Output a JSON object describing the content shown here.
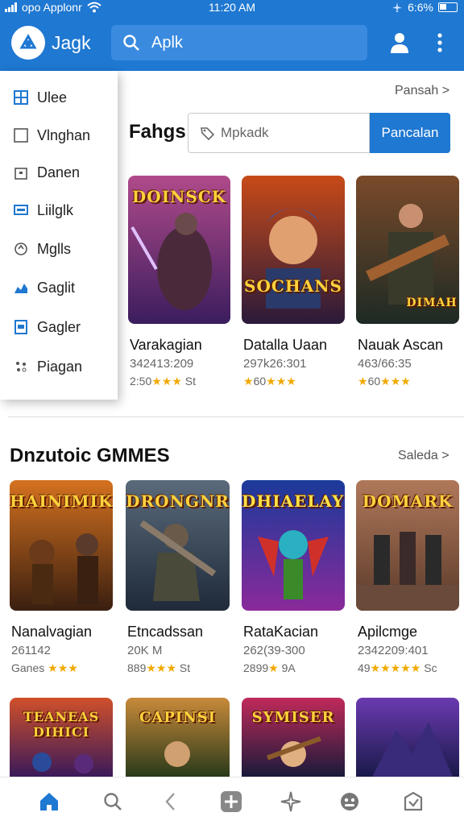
{
  "status_bar": {
    "carrier": "opo Applonr",
    "time": "11:20 AM",
    "battery": "6:6%"
  },
  "app_bar": {
    "title": "Jagk",
    "search_text": "Aplk"
  },
  "drawer": {
    "items": [
      {
        "label": "Ulee",
        "icon": "grid-icon"
      },
      {
        "label": "Vlnghan",
        "icon": "square-icon"
      },
      {
        "label": "Danen",
        "icon": "lock-icon"
      },
      {
        "label": "Liilglk",
        "icon": "chat-icon"
      },
      {
        "label": "Mglls",
        "icon": "refresh-icon"
      },
      {
        "label": "Gaglit",
        "icon": "chart-icon"
      },
      {
        "label": "Gagler",
        "icon": "file-icon"
      },
      {
        "label": "Piagan",
        "icon": "settings-dots-icon"
      }
    ]
  },
  "top_section": {
    "see_all": "Pansah >",
    "title": "Fahgs",
    "search_placeholder": "Mpkadk",
    "search_button": "Pancalan",
    "games": [
      {
        "art_title": "DOINSCK",
        "name": "Varakagian",
        "sub": "342413:209",
        "rating_prefix": "2:50",
        "stars": "★★★",
        "rating_suffix": "St",
        "colors": [
          "#3b1d5e",
          "#b04a8a"
        ]
      },
      {
        "art_title": "SOCHANS",
        "name": "Datalla Uaan",
        "sub": "297k26:301",
        "rating_prefix": "60",
        "stars": "★★★",
        "rating_suffix": "",
        "colors": [
          "#2a1a3a",
          "#c84a18"
        ]
      },
      {
        "art_title": "DIMAH",
        "name": "Nauak Ascan",
        "sub": "463/66:35",
        "rating_prefix": "60",
        "stars": "★★★",
        "rating_suffix": "",
        "colors": [
          "#1d2a24",
          "#7a4a2a"
        ]
      }
    ]
  },
  "section2": {
    "title": "Dnzutoic GMMES",
    "see_all": "Saleda >",
    "games": [
      {
        "art_title": "HAINIMIK",
        "name": "Nanalvagian",
        "sub": "261142",
        "rating_prefix": "Ganes",
        "stars": "★★★",
        "rating_suffix": "",
        "colors": [
          "#3a1f10",
          "#d4711f"
        ]
      },
      {
        "art_title": "DRONGNR",
        "name": "Etncadssan",
        "sub": "20K M",
        "rating_prefix": "889",
        "stars": "★★★",
        "rating_suffix": "St",
        "colors": [
          "#1f2a3a",
          "#5a6a7a"
        ]
      },
      {
        "art_title": "DHIAELAYE",
        "name": "RataKacian",
        "sub": "262(39-300",
        "rating_prefix": "2899",
        "stars": "★",
        "rating_suffix": "9A",
        "colors": [
          "#1a3a9a",
          "#8a2a9a"
        ]
      },
      {
        "art_title": "DOMARK",
        "name": "Apilcmge",
        "sub": "2342209:401",
        "rating_prefix": "49",
        "stars": "★★★★★",
        "rating_suffix": "Sc",
        "colors": [
          "#5a3a2a",
          "#b0785a"
        ]
      }
    ]
  },
  "section3": {
    "games": [
      {
        "art_title": "TEANEAS DIHICI",
        "colors": [
          "#3a1a5a",
          "#d0502a"
        ]
      },
      {
        "art_title": "CAPINSI",
        "colors": [
          "#2a3a1a",
          "#c88a3a"
        ]
      },
      {
        "art_title": "SYMISER",
        "colors": [
          "#1a1a3a",
          "#c02a5a"
        ]
      },
      {
        "art_title": "",
        "colors": [
          "#1a1a4a",
          "#6a3ab0"
        ]
      }
    ]
  },
  "bottom_nav": {
    "items": [
      "home-icon",
      "search-icon",
      "back-icon",
      "add-icon",
      "sparkle-icon",
      "games-icon",
      "store-icon"
    ],
    "active_color": "#1f78d1"
  }
}
